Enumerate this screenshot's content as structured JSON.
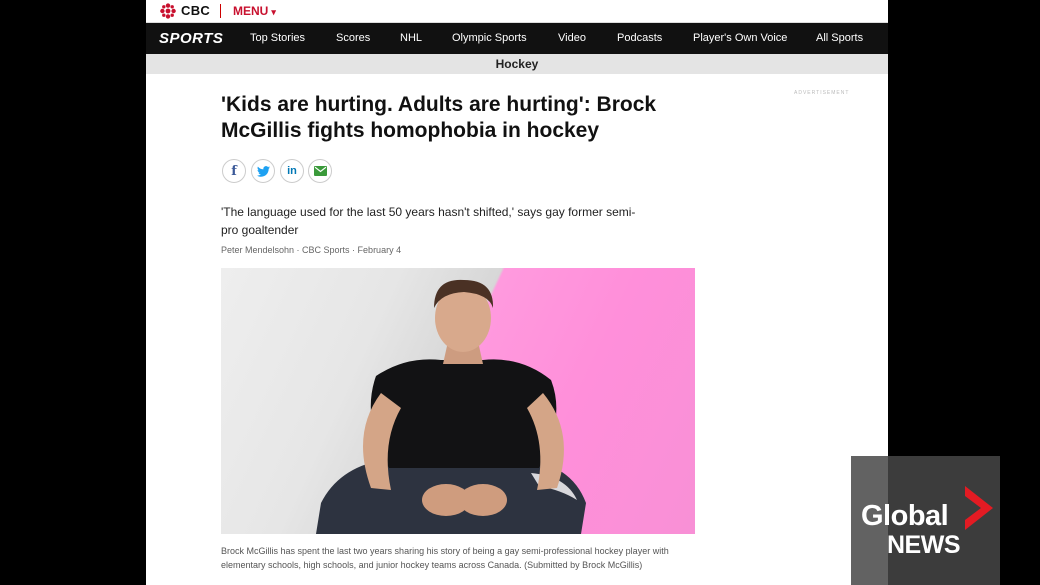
{
  "topbar": {
    "brand": "CBC",
    "menu_label": "MENU",
    "menu_chevron": "▾"
  },
  "sports_nav": {
    "logo": "SPORTS",
    "items": [
      {
        "label": "Top Stories"
      },
      {
        "label": "Scores"
      },
      {
        "label": "NHL"
      },
      {
        "label": "Olympic Sports"
      },
      {
        "label": "Video"
      },
      {
        "label": "Podcasts"
      },
      {
        "label": "Player's Own Voice"
      },
      {
        "label": "All Sports"
      }
    ]
  },
  "section": {
    "title": "Hockey"
  },
  "ad": {
    "label": "ADVERTISEMENT"
  },
  "article": {
    "headline": "'Kids are hurting. Adults are hurting': Brock McGillis fights homophobia in hockey",
    "dek": "'The language used for the last 50 years hasn't shifted,' says gay former semi-pro goaltender",
    "byline": "Peter Mendelsohn · CBC Sports · February 4",
    "caption": "Brock McGillis has spent the last two years sharing his story of being a gay semi-professional hockey player with elementary schools, high schools, and junior hockey teams across Canada. (Submitted by Brock McGillis)"
  },
  "share": [
    {
      "icon": "facebook-icon",
      "glyph": "f",
      "color": "#3b5998"
    },
    {
      "icon": "twitter-icon",
      "glyph": "🐦",
      "color": "#1da1f2"
    },
    {
      "icon": "linkedin-icon",
      "glyph": "in",
      "color": "#0077b5"
    },
    {
      "icon": "email-icon",
      "glyph": "✉",
      "color": "#3a9a3a"
    }
  ],
  "broadcast_bug": {
    "line1": "Global",
    "line2": "NEWS",
    "accent": "#e31b23"
  }
}
